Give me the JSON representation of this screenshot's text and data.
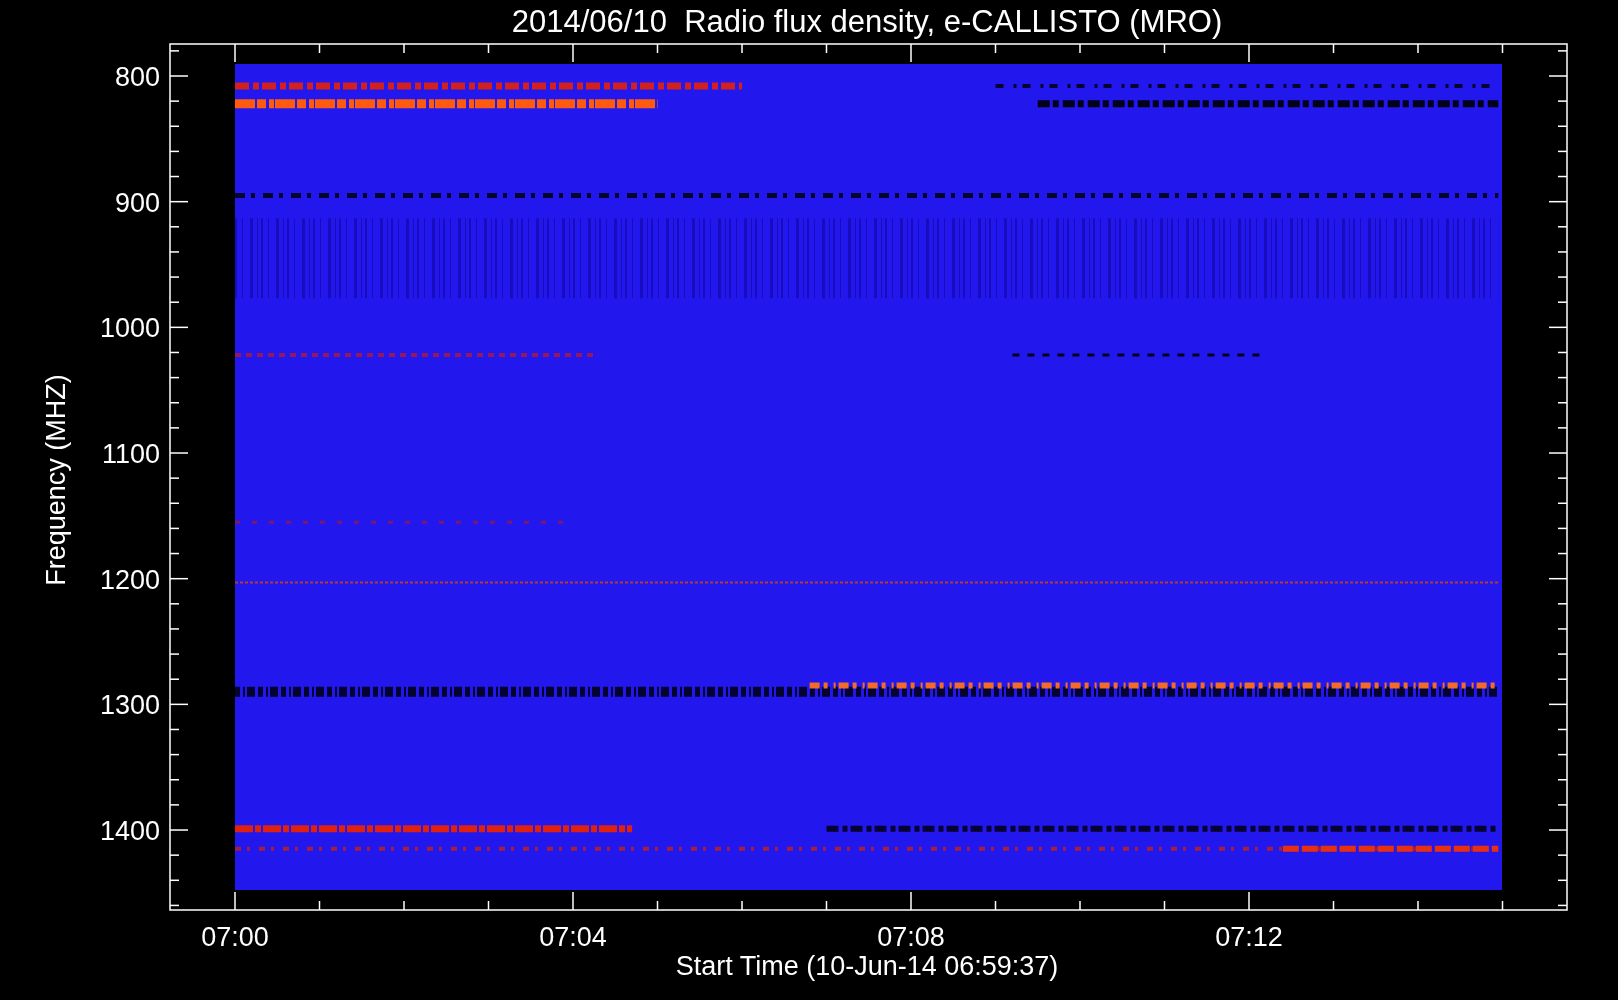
{
  "title": "2014/06/10  Radio flux density, e-CALLISTO (MRO)",
  "y_axis": {
    "label": "Frequency (MHZ)",
    "ticks": [
      "800",
      "900",
      "1000",
      "1100",
      "1200",
      "1300",
      "1400"
    ]
  },
  "x_axis": {
    "label": "Start Time (10-Jun-14 06:59:37)",
    "ticks": [
      "07:00",
      "07:04",
      "07:08",
      "07:12"
    ]
  }
}
